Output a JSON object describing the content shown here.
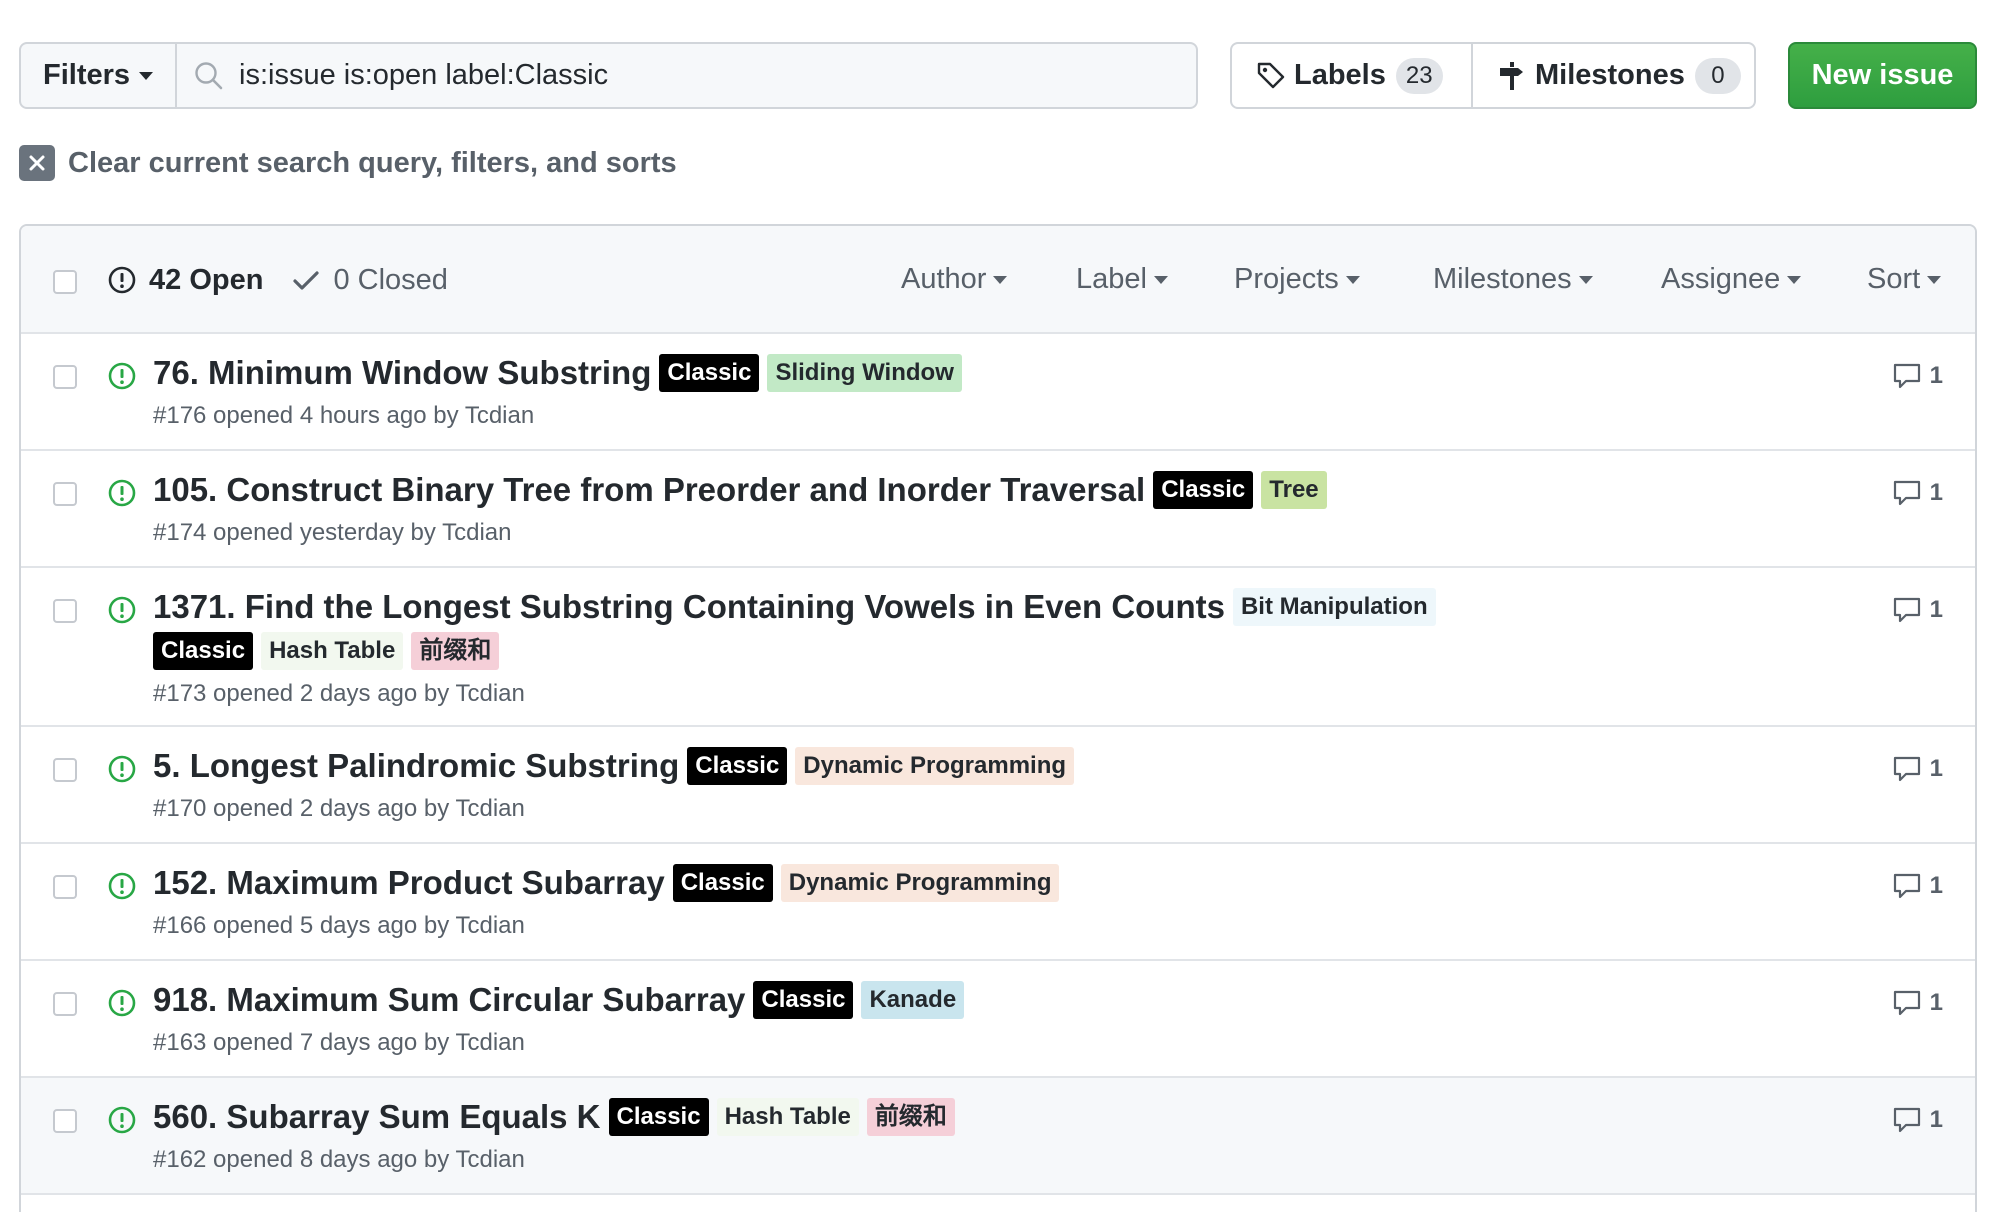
{
  "toolbar": {
    "filters_label": "Filters",
    "search_value": "is:issue is:open label:Classic",
    "labels_label": "Labels",
    "labels_count": "23",
    "milestones_label": "Milestones",
    "milestones_count": "0",
    "new_issue_label": "New issue"
  },
  "clear_query": {
    "label": "Clear current search query, filters, and sorts"
  },
  "list_header": {
    "open_label": "42 Open",
    "closed_label": "0 Closed",
    "filters": [
      "Author",
      "Label",
      "Projects",
      "Milestones",
      "Assignee",
      "Sort"
    ]
  },
  "label_colors": {
    "Classic": {
      "bg": "#000000",
      "fg": "#ffffff"
    },
    "Sliding Window": {
      "bg": "#c2e9c6",
      "fg": "#24292e"
    },
    "Tree": {
      "bg": "#c9e3a2",
      "fg": "#24292e"
    },
    "Bit Manipulation": {
      "bg": "#eef7fb",
      "fg": "#24292e"
    },
    "Hash Table": {
      "bg": "#f2f8ef",
      "fg": "#24292e"
    },
    "前缀和": {
      "bg": "#f5cfd8",
      "fg": "#24292e"
    },
    "Dynamic Programming": {
      "bg": "#f9e7dd",
      "fg": "#24292e"
    },
    "Kanade": {
      "bg": "#c9e5ee",
      "fg": "#24292e"
    }
  },
  "issues": [
    {
      "title": "76. Minimum Window Substring",
      "labels": [
        "Classic",
        "Sliding Window"
      ],
      "meta": "#176 opened 4 hours ago by Tcdian",
      "comments": "1"
    },
    {
      "title": "105. Construct Binary Tree from Preorder and Inorder Traversal",
      "labels": [
        "Classic",
        "Tree"
      ],
      "meta": "#174 opened yesterday by Tcdian",
      "comments": "1"
    },
    {
      "title": "1371. Find the Longest Substring Containing Vowels in Even Counts",
      "labels": [
        "Bit Manipulation",
        "Classic",
        "Hash Table",
        "前缀和"
      ],
      "meta": "#173 opened 2 days ago by Tcdian",
      "comments": "1"
    },
    {
      "title": "5. Longest Palindromic Substring",
      "labels": [
        "Classic",
        "Dynamic Programming"
      ],
      "meta": "#170 opened 2 days ago by Tcdian",
      "comments": "1"
    },
    {
      "title": "152. Maximum Product Subarray",
      "labels": [
        "Classic",
        "Dynamic Programming"
      ],
      "meta": "#166 opened 5 days ago by Tcdian",
      "comments": "1"
    },
    {
      "title": "918. Maximum Sum Circular Subarray",
      "labels": [
        "Classic",
        "Kanade"
      ],
      "meta": "#163 opened 7 days ago by Tcdian",
      "comments": "1"
    },
    {
      "title": "560. Subarray Sum Equals K",
      "labels": [
        "Classic",
        "Hash Table",
        "前缀和"
      ],
      "meta": "#162 opened 8 days ago by Tcdian",
      "comments": "1"
    }
  ],
  "icons": {
    "search": "search-icon",
    "tag": "tag-icon",
    "milestone": "milestone-icon",
    "clear": "close-icon",
    "issue_open": "issue-opened-icon",
    "check": "check-icon",
    "comment": "comment-icon"
  },
  "colors": {
    "accent_green": "#2ea44f",
    "open_icon_green": "#28a745",
    "muted_text": "#586069"
  }
}
